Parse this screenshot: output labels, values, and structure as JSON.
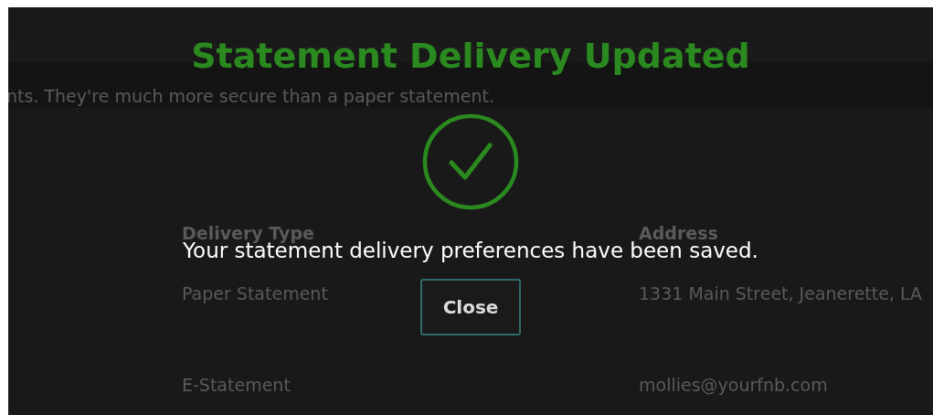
{
  "background_page": {
    "intro_text": "nts. They're much more secure than a paper statement.",
    "table": {
      "columns": [
        "Delivery Type",
        "Address"
      ],
      "rows": [
        [
          "Paper Statement",
          "1331 Main Street, Jeanerette, LA"
        ],
        [
          "E-Statement",
          "mollies@yourfnb.com"
        ]
      ]
    }
  },
  "dialog": {
    "title": "Statement Delivery Updated",
    "message": "Your statement delivery preferences have been saved.",
    "button": "Close"
  }
}
